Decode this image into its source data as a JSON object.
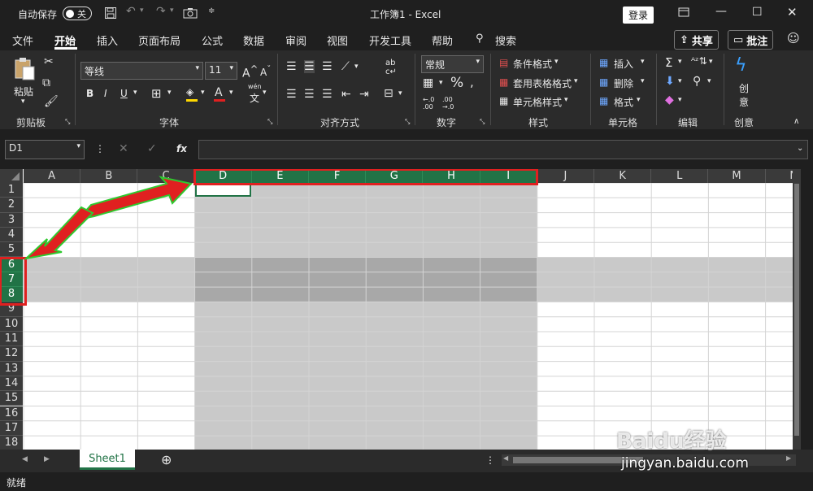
{
  "titlebar": {
    "autosave_label": "自动保存",
    "autosave_state": "关",
    "title": "工作簿1  -  Excel",
    "login": "登录"
  },
  "menu": {
    "items": [
      "文件",
      "开始",
      "插入",
      "页面布局",
      "公式",
      "数据",
      "审阅",
      "视图",
      "开发工具",
      "帮助"
    ],
    "search": "搜索",
    "share": "共享",
    "comments": "批注"
  },
  "ribbon": {
    "clipboard": {
      "paste": "粘贴",
      "label": "剪贴板"
    },
    "font": {
      "name": "等线",
      "size": "11",
      "bold": "B",
      "italic": "I",
      "underline": "U",
      "color_a": "A",
      "wen": "wén",
      "label": "字体"
    },
    "align": {
      "label": "对齐方式"
    },
    "number": {
      "format": "常规",
      "percent": "%",
      "label": "数字"
    },
    "styles": {
      "conditional": "条件格式",
      "table": "套用表格格式",
      "cell": "单元格样式",
      "label": "样式"
    },
    "cells": {
      "insert": "插入",
      "delete": "删除",
      "format": "格式",
      "label": "单元格"
    },
    "editing": {
      "label": "编辑"
    },
    "creativity": {
      "btn1": "创",
      "btn2": "意",
      "label": "创意"
    }
  },
  "formula_bar": {
    "name_box": "D1",
    "fx": "fx"
  },
  "grid": {
    "columns": [
      "A",
      "B",
      "C",
      "D",
      "E",
      "F",
      "G",
      "H",
      "I",
      "J",
      "K",
      "L",
      "M",
      "N"
    ],
    "rows": [
      "1",
      "2",
      "3",
      "4",
      "5",
      "6",
      "7",
      "8",
      "9",
      "10",
      "11",
      "12",
      "13",
      "14",
      "15",
      "16",
      "17",
      "18"
    ]
  },
  "sheets": {
    "tab": "Sheet1"
  },
  "status": {
    "text": "就绪"
  },
  "watermark": {
    "brand": "Baidu经验",
    "url": "jingyan.baidu.com"
  },
  "colors": {
    "accent": "#217346",
    "highlight": "#e02020",
    "arrow": "#2fc92f"
  }
}
